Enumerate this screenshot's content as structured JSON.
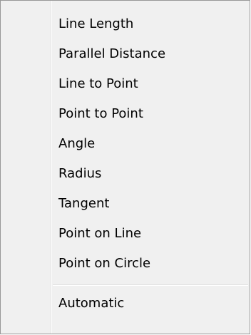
{
  "menu": {
    "items": [
      {
        "label": "Line Length"
      },
      {
        "label": "Parallel Distance"
      },
      {
        "label": "Line to Point"
      },
      {
        "label": "Point to Point"
      },
      {
        "label": "Angle"
      },
      {
        "label": "Radius"
      },
      {
        "label": "Tangent"
      },
      {
        "label": "Point on Line"
      },
      {
        "label": "Point on Circle"
      }
    ],
    "after_separator": [
      {
        "label": "Automatic"
      }
    ]
  }
}
